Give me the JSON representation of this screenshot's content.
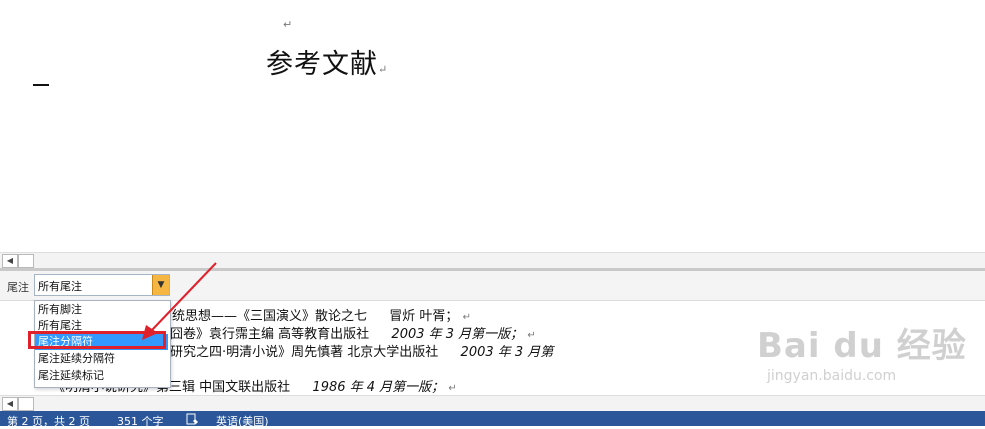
{
  "document": {
    "title": "参考文献",
    "para_mark": "↵"
  },
  "notes_pane": {
    "label": "尾注",
    "selected": "所有尾注",
    "dropdown_arrow": "▼",
    "options": [
      "所有脚注",
      "所有尾注",
      "尾注分隔符",
      "尾注延续分隔符",
      "尾注延续标记"
    ],
    "selected_option": "尾注分隔符",
    "lines": [
      {
        "t1": "统思想——《三国演义》散论之七",
        "t2": "冒炘   叶胥；",
        "t3": ""
      },
      {
        "t1": "囧卷》袁行霈主编   高等教育出版社",
        "t2": "2003 年 3 月第一版；",
        "t3": ""
      },
      {
        "t1": "研究之四·明清小说》周先慎著   北京大学出版社",
        "t2": "2003 年 3 月第",
        "t3": ""
      },
      {
        "t1": "《明清小说研究》第三辑   中国文联出版社",
        "t2": "1986 年 4 月第一版；",
        "t3": ""
      }
    ]
  },
  "scroll": {
    "left_arrow": "◀"
  },
  "status_bar": {
    "page": "第 2 页，共 2 页",
    "words": "351 个字",
    "proof_icon": "proofing-icon",
    "language": "英语(美国)"
  },
  "watermark": {
    "logo": "Bai du 经验",
    "url": "jingyan.baidu.com"
  },
  "colors": {
    "status_bar": "#2b579a",
    "highlight": "#e0202a",
    "selection": "#3399ff",
    "dropdown_button": "#f5b642"
  }
}
